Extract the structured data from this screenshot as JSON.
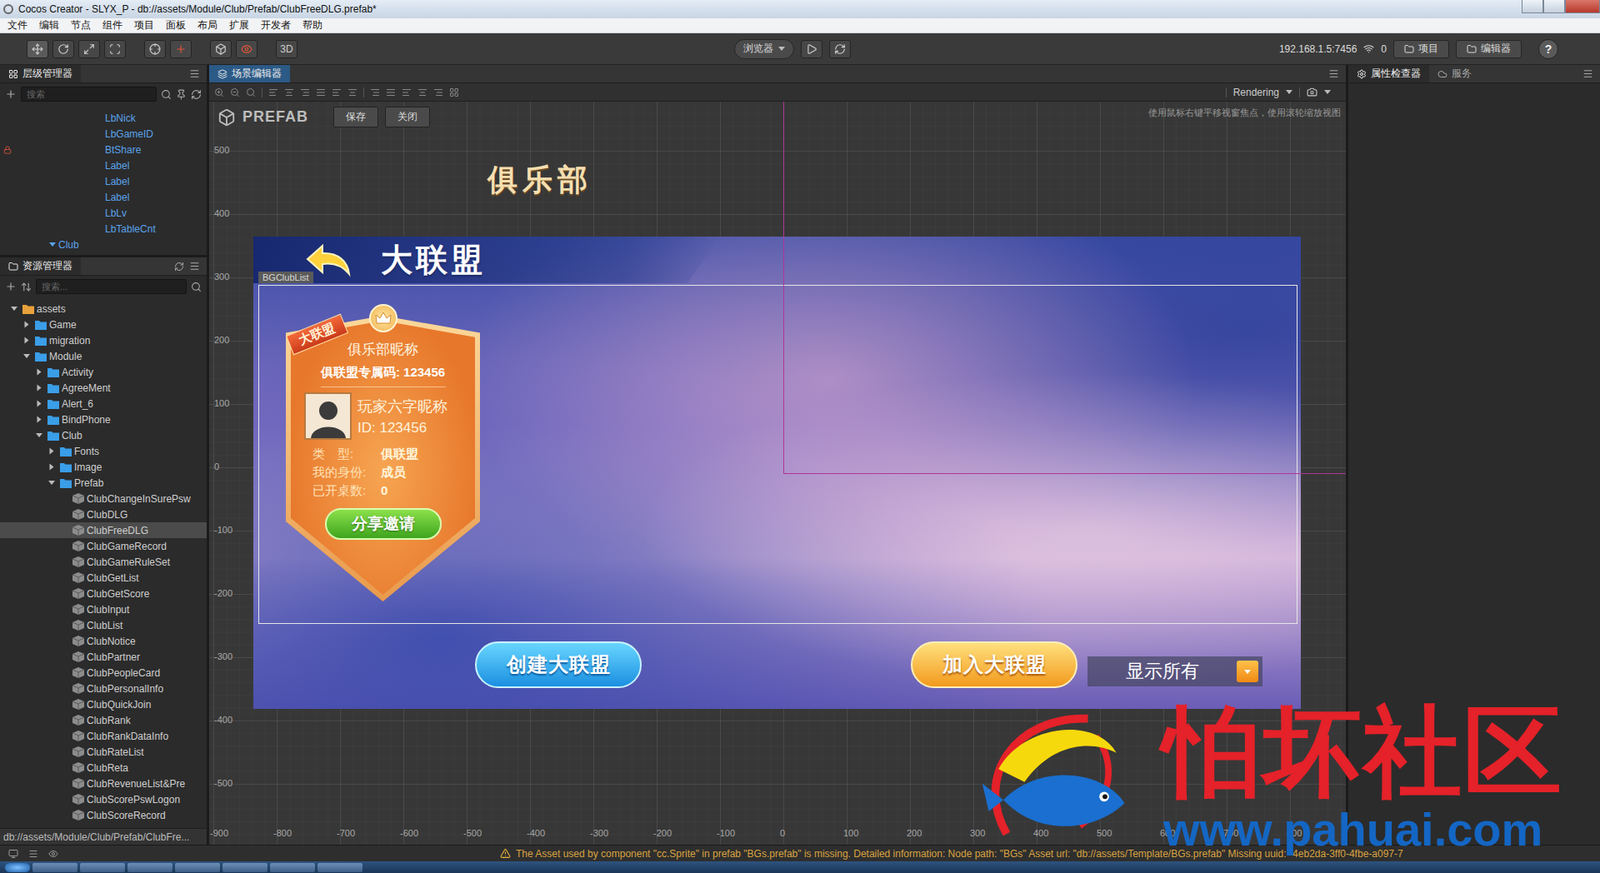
{
  "window": {
    "title": "Cocos Creator - SLYX_P - db://assets/Module/Club/Prefab/ClubFreeDLG.prefab*"
  },
  "menu": [
    "文件",
    "编辑",
    "节点",
    "组件",
    "项目",
    "面板",
    "布局",
    "扩展",
    "开发者",
    "帮助"
  ],
  "toolbar": {
    "view_3d": "3D",
    "preview": "浏览器",
    "server": "192.168.1.5:7456",
    "connections": "0",
    "project": "项目",
    "editor": "编辑器",
    "help": "?"
  },
  "hierarchy": {
    "title": "层级管理器",
    "search_placeholder": "搜索",
    "items": [
      {
        "name": "LbNick",
        "kind": "leaf",
        "depth": 6,
        "expanded": false,
        "locked": false
      },
      {
        "name": "LbGameID",
        "kind": "leaf",
        "depth": 6,
        "expanded": false,
        "locked": false
      },
      {
        "name": "BtShare",
        "kind": "leaf",
        "depth": 6,
        "expanded": false,
        "locked": true
      },
      {
        "name": "Label",
        "kind": "leaf",
        "depth": 6,
        "expanded": false,
        "locked": false
      },
      {
        "name": "Label",
        "kind": "leaf",
        "depth": 6,
        "expanded": false,
        "locked": false
      },
      {
        "name": "Label",
        "kind": "leaf",
        "depth": 6,
        "expanded": false,
        "locked": false
      },
      {
        "name": "LbLv",
        "kind": "leaf",
        "depth": 6,
        "expanded": false,
        "locked": false
      },
      {
        "name": "LbTableCnt",
        "kind": "leaf",
        "depth": 6,
        "expanded": false,
        "locked": false
      },
      {
        "name": "Club",
        "kind": "parent",
        "depth": 2,
        "expanded": true,
        "locked": false
      }
    ]
  },
  "assets": {
    "title": "资源管理器",
    "search_placeholder": "搜索...",
    "footer": "db://assets/Module/Club/Prefab/ClubFre...",
    "items": [
      {
        "name": "assets",
        "kind": "root",
        "depth": 0,
        "expanded": true,
        "selected": false
      },
      {
        "name": "Game",
        "kind": "folder",
        "depth": 1,
        "expanded": false,
        "selected": false
      },
      {
        "name": "migration",
        "kind": "folder",
        "depth": 1,
        "expanded": false,
        "selected": false
      },
      {
        "name": "Module",
        "kind": "folder",
        "depth": 1,
        "expanded": true,
        "selected": false
      },
      {
        "name": "Activity",
        "kind": "folder",
        "depth": 2,
        "expanded": false,
        "selected": false
      },
      {
        "name": "AgreeMent",
        "kind": "folder",
        "depth": 2,
        "expanded": false,
        "selected": false
      },
      {
        "name": "Alert_6",
        "kind": "folder",
        "depth": 2,
        "expanded": false,
        "selected": false
      },
      {
        "name": "BindPhone",
        "kind": "folder",
        "depth": 2,
        "expanded": false,
        "selected": false
      },
      {
        "name": "Club",
        "kind": "folder",
        "depth": 2,
        "expanded": true,
        "selected": false
      },
      {
        "name": "Fonts",
        "kind": "folder",
        "depth": 3,
        "expanded": false,
        "selected": false
      },
      {
        "name": "Image",
        "kind": "folder",
        "depth": 3,
        "expanded": false,
        "selected": false
      },
      {
        "name": "Prefab",
        "kind": "folder",
        "depth": 3,
        "expanded": true,
        "selected": false
      },
      {
        "name": "ClubChangeInSurePsw",
        "kind": "prefab",
        "depth": 4,
        "expanded": false,
        "selected": false
      },
      {
        "name": "ClubDLG",
        "kind": "prefab",
        "depth": 4,
        "expanded": false,
        "selected": false
      },
      {
        "name": "ClubFreeDLG",
        "kind": "prefab",
        "depth": 4,
        "expanded": false,
        "selected": true
      },
      {
        "name": "ClubGameRecord",
        "kind": "prefab",
        "depth": 4,
        "expanded": false,
        "selected": false
      },
      {
        "name": "ClubGameRuleSet",
        "kind": "prefab",
        "depth": 4,
        "expanded": false,
        "selected": false
      },
      {
        "name": "ClubGetList",
        "kind": "prefab",
        "depth": 4,
        "expanded": false,
        "selected": false
      },
      {
        "name": "ClubGetScore",
        "kind": "prefab",
        "depth": 4,
        "expanded": false,
        "selected": false
      },
      {
        "name": "ClubInput",
        "kind": "prefab",
        "depth": 4,
        "expanded": false,
        "selected": false
      },
      {
        "name": "ClubList",
        "kind": "prefab",
        "depth": 4,
        "expanded": false,
        "selected": false
      },
      {
        "name": "ClubNotice",
        "kind": "prefab",
        "depth": 4,
        "expanded": false,
        "selected": false
      },
      {
        "name": "ClubPartner",
        "kind": "prefab",
        "depth": 4,
        "expanded": false,
        "selected": false
      },
      {
        "name": "ClubPeopleCard",
        "kind": "prefab",
        "depth": 4,
        "expanded": false,
        "selected": false
      },
      {
        "name": "ClubPersonalInfo",
        "kind": "prefab",
        "depth": 4,
        "expanded": false,
        "selected": false
      },
      {
        "name": "ClubQuickJoin",
        "kind": "prefab",
        "depth": 4,
        "expanded": false,
        "selected": false
      },
      {
        "name": "ClubRank",
        "kind": "prefab",
        "depth": 4,
        "expanded": false,
        "selected": false
      },
      {
        "name": "ClubRankDataInfo",
        "kind": "prefab",
        "depth": 4,
        "expanded": false,
        "selected": false
      },
      {
        "name": "ClubRateList",
        "kind": "prefab",
        "depth": 4,
        "expanded": false,
        "selected": false
      },
      {
        "name": "ClubReta",
        "kind": "prefab",
        "depth": 4,
        "expanded": false,
        "selected": false
      },
      {
        "name": "ClubRevenueList&Pre",
        "kind": "prefab",
        "depth": 4,
        "expanded": false,
        "selected": false
      },
      {
        "name": "ClubScorePswLogon",
        "kind": "prefab",
        "depth": 4,
        "expanded": false,
        "selected": false
      },
      {
        "name": "ClubScoreRecord",
        "kind": "prefab",
        "depth": 4,
        "expanded": false,
        "selected": false
      }
    ]
  },
  "scene": {
    "tab": "场景编辑器",
    "render_mode": "Rendering",
    "mode_label": "PREFAB",
    "save_button": "保存",
    "close_button": "关闭",
    "hint": "使用鼠标右键平移视窗焦点，使用滚轮缩放视图",
    "y_ticks": [
      "500",
      "400",
      "300",
      "200",
      "100",
      "0",
      "-100",
      "-200",
      "-300",
      "-400",
      "-500"
    ],
    "x_ticks": [
      "-900",
      "-800",
      "-700",
      "-600",
      "-500",
      "-400",
      "-300",
      "-200",
      "-100",
      "0",
      "100",
      "200",
      "300",
      "400",
      "500",
      "600",
      "700",
      "800"
    ],
    "node_label": "BGClubList",
    "game": {
      "title": "俱乐部",
      "header": "大联盟",
      "card": {
        "ribbon": "大联盟",
        "club_name": "俱乐部昵称",
        "code": "俱联盟专属码: 123456",
        "player_name": "玩家六字昵称",
        "player_id": "ID: 123456",
        "rows": [
          {
            "label": "类　型:",
            "value": "俱联盟"
          },
          {
            "label": "我的身份:",
            "value": "成员"
          },
          {
            "label": "已开桌数:",
            "value": "0"
          }
        ],
        "button": "分享邀请"
      },
      "create_button": "创建大联盟",
      "join_button": "加入大联盟",
      "filter": "显示所有"
    }
  },
  "inspector": {
    "tabs": [
      {
        "label": "属性检查器",
        "selected": true
      },
      {
        "label": "服务",
        "selected": false
      }
    ]
  },
  "status_bar": {
    "message": "The Asset used by component \"cc.Sprite\" in prefab \"BGs.prefab\" is missing. Detailed information: Node path: \"BGs\" Asset url: \"db://assets/Template/BGs.prefab\" Missing uuid: \"4eb2da-3ff0-4fbe-a097-7"
  },
  "watermark": {
    "name": "怕坏社区",
    "url": "www.pahuai.com"
  }
}
